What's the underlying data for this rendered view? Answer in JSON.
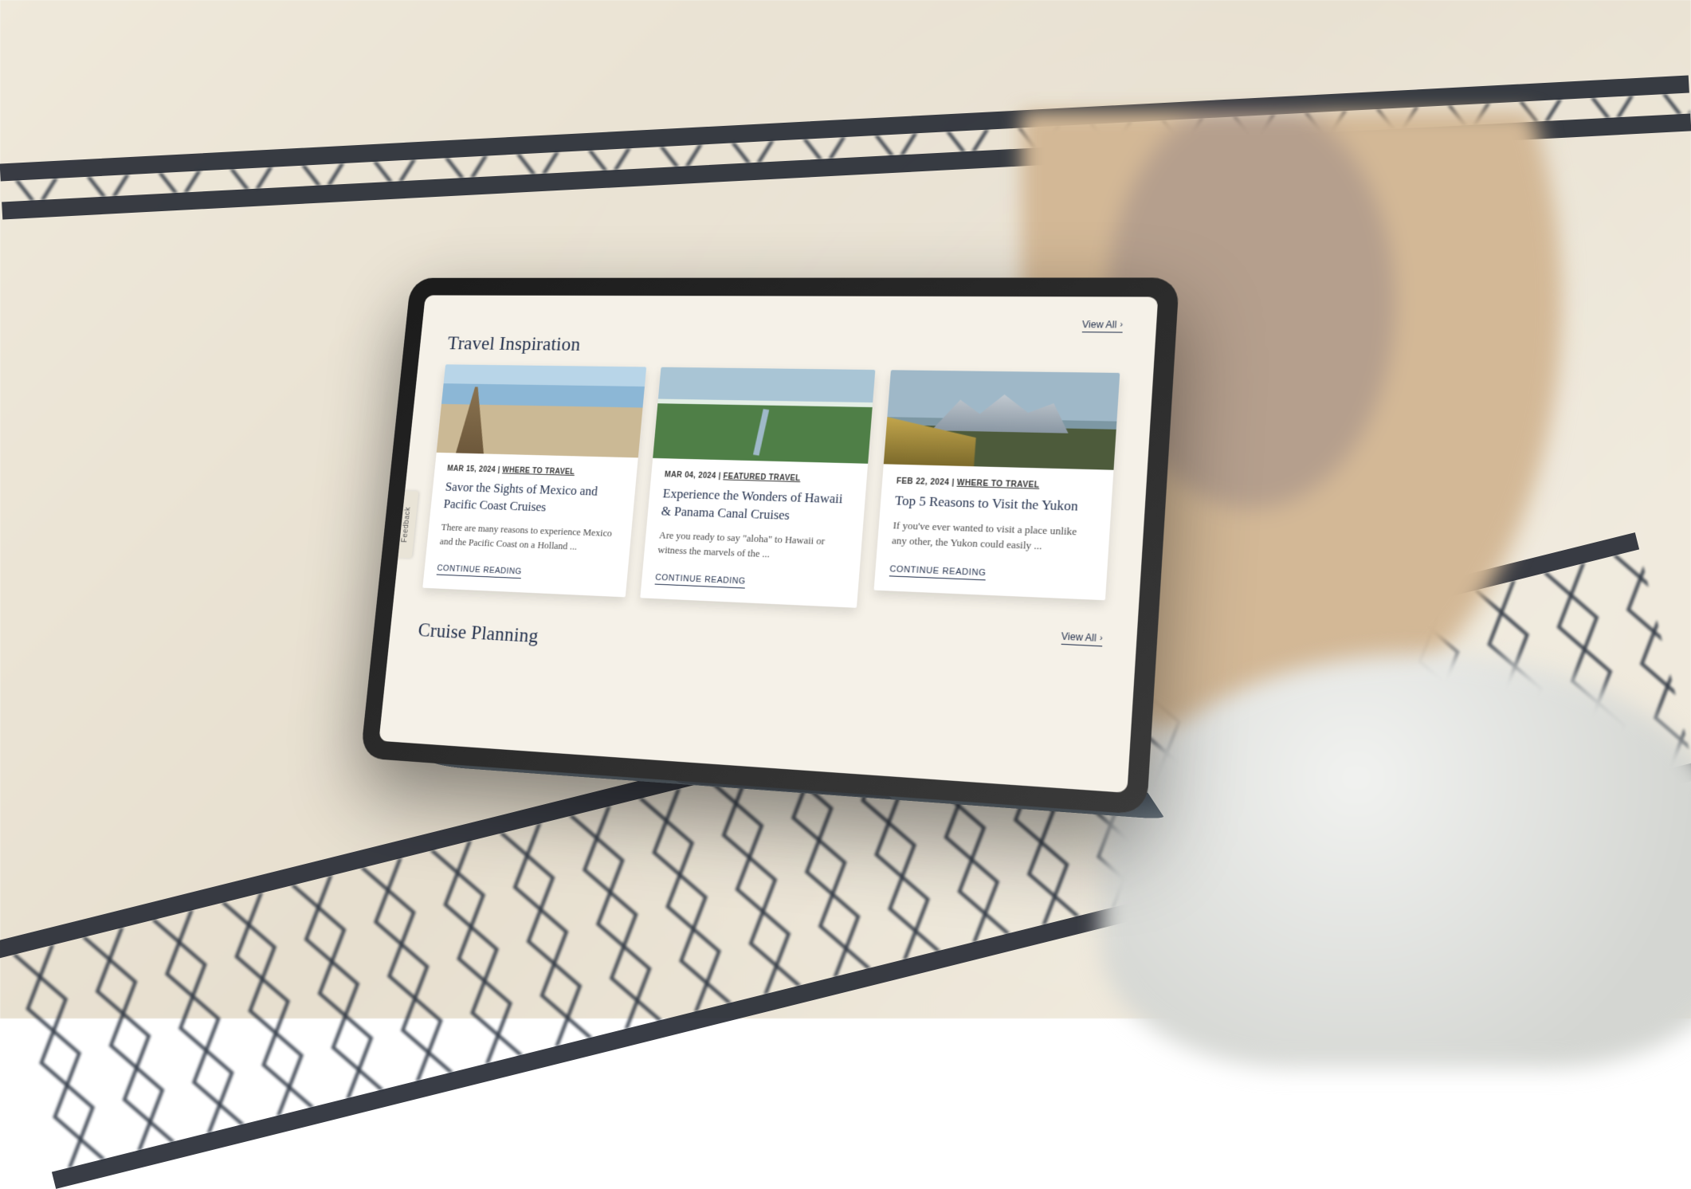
{
  "feedbackTabLabel": "Feedback",
  "section1": {
    "title": "Travel Inspiration",
    "viewAllLabel": "View All",
    "cards": [
      {
        "date": "MAR 15, 2024",
        "category": "WHERE TO TRAVEL",
        "title": "Savor the Sights of Mexico and Pacific Coast Cruises",
        "excerpt": "There are many reasons to experience Mexico and the Pacific Coast on a Holland ...",
        "cta": "CONTINUE READING"
      },
      {
        "date": "MAR 04, 2024",
        "category": "FEATURED TRAVEL",
        "title": "Experience the Wonders of Hawaii & Panama Canal Cruises",
        "excerpt": "Are you ready to say \"aloha\" to Hawaii or witness the marvels of the ...",
        "cta": "CONTINUE READING"
      },
      {
        "date": "FEB 22, 2024",
        "category": "WHERE TO TRAVEL",
        "title": "Top 5 Reasons to Visit the Yukon",
        "excerpt": "If you've ever wanted to visit a place unlike any other, the Yukon could easily ...",
        "cta": "CONTINUE READING"
      }
    ]
  },
  "section2": {
    "title": "Cruise Planning",
    "viewAllLabel": "View All"
  }
}
